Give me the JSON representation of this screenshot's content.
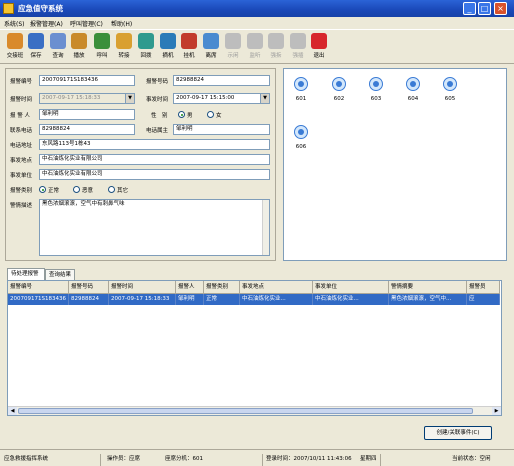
{
  "window": {
    "title": "应急值守系统",
    "min": "_",
    "max": "□",
    "close": "×"
  },
  "menu": [
    "系统(S)",
    "报警管理(A)",
    "呼叫管理(C)",
    "帮助(H)"
  ],
  "toolbar": [
    {
      "label": "交接班",
      "icon": "handover-icon",
      "color": "#d98a2b",
      "enabled": true
    },
    {
      "label": "保存",
      "icon": "save-icon",
      "color": "#3a6fc4",
      "enabled": true
    },
    {
      "label": "查询",
      "icon": "search-icon",
      "color": "#6b8fd0",
      "enabled": true
    },
    {
      "label": "播放",
      "icon": "play-icon",
      "color": "#c98a2a",
      "enabled": true
    },
    {
      "label": "呼叫",
      "icon": "call-icon",
      "color": "#3b8f3b",
      "enabled": true
    },
    {
      "label": "转接",
      "icon": "transfer-icon",
      "color": "#d9a030",
      "enabled": true
    },
    {
      "label": "回拨",
      "icon": "callback-icon",
      "color": "#2f9a8e",
      "enabled": true
    },
    {
      "label": "摘机",
      "icon": "offhook-icon",
      "color": "#2a7bb8",
      "enabled": true
    },
    {
      "label": "挂机",
      "icon": "hangup-icon",
      "color": "#c23b2b",
      "enabled": true
    },
    {
      "label": "离席",
      "icon": "away-icon",
      "color": "#4a8bd0",
      "enabled": true
    },
    {
      "label": "示闲",
      "icon": "idle-icon",
      "color": "#bdbdbd",
      "enabled": false
    },
    {
      "label": "监听",
      "icon": "listen-icon",
      "color": "#bdbdbd",
      "enabled": false
    },
    {
      "label": "强拆",
      "icon": "forcebreak-icon",
      "color": "#bdbdbd",
      "enabled": false
    },
    {
      "label": "强插",
      "icon": "forceinsert-icon",
      "color": "#bdbdbd",
      "enabled": false
    },
    {
      "label": "退出",
      "icon": "exit-icon",
      "color": "#d7262b",
      "enabled": true
    }
  ],
  "form": {
    "alarm_no_label": "报警编号",
    "alarm_no": "200709171S183436",
    "caller_no_label": "报警号码",
    "caller_no": "82988824",
    "alarm_time_label": "报警时间",
    "alarm_time": "2007-09-17 15:18:33",
    "event_time_label": "事发时间",
    "event_time": "2007-09-17 15:15:00",
    "caller_label": "报 警 人",
    "caller": "邹利明",
    "gender_label": "性　别",
    "gender_male": "男",
    "gender_female": "女",
    "contact_label": "联系电话",
    "contact": "82988824",
    "owner_label": "电话属主",
    "owner": "邹利明",
    "phone_addr_label": "电话地址",
    "phone_addr": "东风路113号1栋43",
    "event_place_label": "事发地点",
    "event_place": "中石油炼化实业有限公司",
    "event_unit_label": "事发单位",
    "event_unit": "中石油炼化实业有限公司",
    "category_label": "报警类别",
    "cat_normal": "正常",
    "cat_malicious": "恶意",
    "cat_other": "其它",
    "desc_label": "警情描述",
    "desc": "黑色浓烟滚滚，空气中有刺鼻气味"
  },
  "seats": [
    "601",
    "602",
    "603",
    "604",
    "605",
    "606"
  ],
  "tabs": [
    "待处理报警",
    "查询结果"
  ],
  "table": {
    "headers": [
      "报警编号",
      "报警号码",
      "报警时间",
      "报警人",
      "报警类别",
      "事发地点",
      "事发单位",
      "警情摘要",
      "报警员"
    ],
    "rows": [
      [
        "200709171S183436",
        "82988824",
        "2007-09-17 15:18:33",
        "邹利明",
        "正常",
        "中石油炼化实业...",
        "中石油炼化实业...",
        "黑色浓烟滚滚，空气中...",
        "应"
      ]
    ]
  },
  "create_button": "创建/关联事件(C)",
  "status": {
    "system": "应急救援指挥系统",
    "operator": "操作员：应席",
    "extension": "座席分机：601",
    "login_time": "登录时间：2007/10/11 11:43:06",
    "weekday": "星期四",
    "state": "当前状态：空闲"
  }
}
